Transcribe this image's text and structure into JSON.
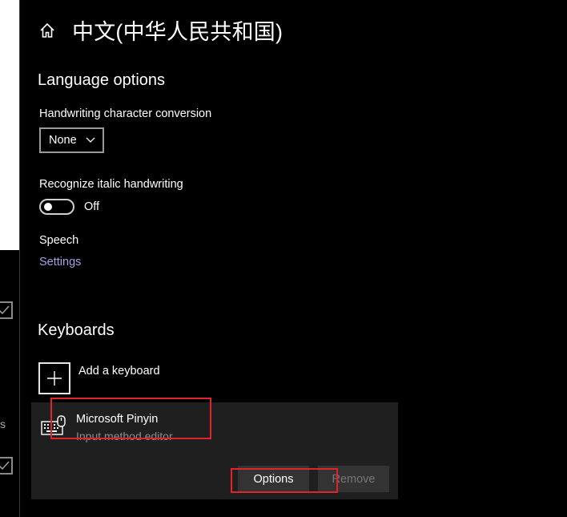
{
  "header": {
    "title": "中文(中华人民共和国)",
    "home_icon": "home-icon"
  },
  "language_options": {
    "heading": "Language options",
    "handwriting_label": "Handwriting character conversion",
    "handwriting_value": "None",
    "italic_label": "Recognize italic handwriting",
    "italic_state": "Off",
    "speech_label": "Speech",
    "speech_link": "Settings"
  },
  "keyboards": {
    "heading": "Keyboards",
    "add_label": "Add a keyboard",
    "items": [
      {
        "name": "Microsoft Pinyin",
        "subtitle": "Input method editor",
        "icon": "keyboard-icon",
        "options_label": "Options",
        "remove_label": "Remove"
      }
    ]
  },
  "left_panel": {
    "partial_text": "s"
  },
  "colors": {
    "background": "#000000",
    "link": "#a6a0e6",
    "card": "#1f1f1f",
    "highlight": "#e0242a"
  }
}
